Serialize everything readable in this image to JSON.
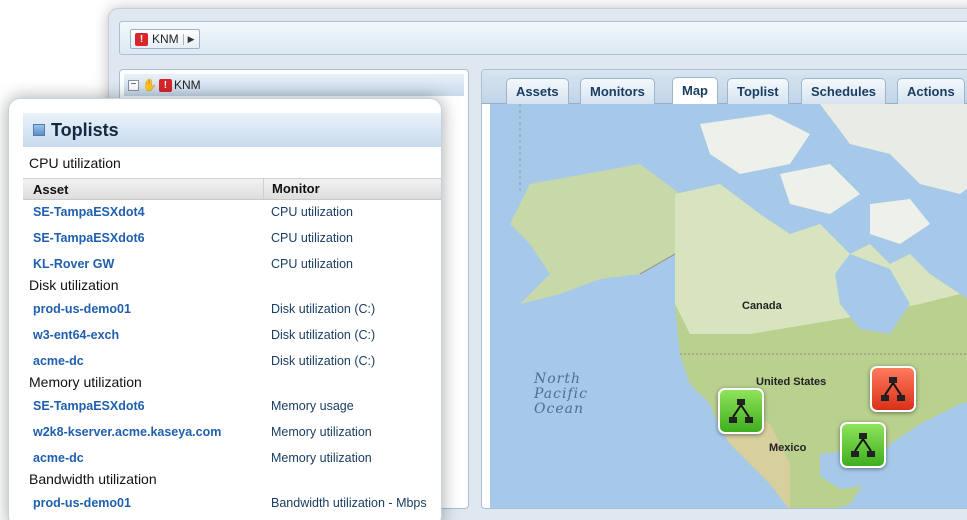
{
  "breadcrumb": {
    "label": "KNM"
  },
  "tree": {
    "root_label": "KNM"
  },
  "tabs": [
    {
      "label": "Assets",
      "active": false
    },
    {
      "label": "Monitors",
      "active": false
    },
    {
      "label": "Map",
      "active": true
    },
    {
      "label": "Toplist",
      "active": false
    },
    {
      "label": "Schedules",
      "active": false
    },
    {
      "label": "Actions",
      "active": false
    }
  ],
  "map": {
    "labels": {
      "canada": "Canada",
      "united_states": "United States",
      "mexico": "Mexico",
      "ocean_line1": "North",
      "ocean_line2": "Pacific",
      "ocean_line3": "Ocean"
    },
    "markers": [
      {
        "status": "ok",
        "color": "#4caf2a"
      },
      {
        "status": "ok",
        "color": "#4caf2a"
      },
      {
        "status": "alert",
        "color": "#e0401f"
      }
    ]
  },
  "toplists": {
    "title": "Toplists",
    "columns": {
      "asset": "Asset",
      "monitor": "Monitor"
    },
    "sections": [
      {
        "title": "CPU utilization",
        "rows": [
          {
            "asset": "SE-TampaESXdot4",
            "monitor": "CPU utilization"
          },
          {
            "asset": "SE-TampaESXdot6",
            "monitor": "CPU utilization"
          },
          {
            "asset": "KL-Rover GW",
            "monitor": "CPU utilization"
          }
        ]
      },
      {
        "title": "Disk utilization",
        "rows": [
          {
            "asset": "prod-us-demo01",
            "monitor": "Disk utilization (C:)"
          },
          {
            "asset": "w3-ent64-exch",
            "monitor": "Disk utilization (C:)"
          },
          {
            "asset": "acme-dc",
            "monitor": "Disk utilization (C:)"
          }
        ]
      },
      {
        "title": "Memory utilization",
        "rows": [
          {
            "asset": "SE-TampaESXdot6",
            "monitor": "Memory usage"
          },
          {
            "asset": "w2k8-kserver.acme.kaseya.com",
            "monitor": "Memory utilization"
          },
          {
            "asset": "acme-dc",
            "monitor": "Memory utilization"
          }
        ]
      },
      {
        "title": "Bandwidth utilization",
        "rows": [
          {
            "asset": "prod-us-demo01",
            "monitor": "Bandwidth utilization - Mbps"
          }
        ]
      }
    ]
  }
}
